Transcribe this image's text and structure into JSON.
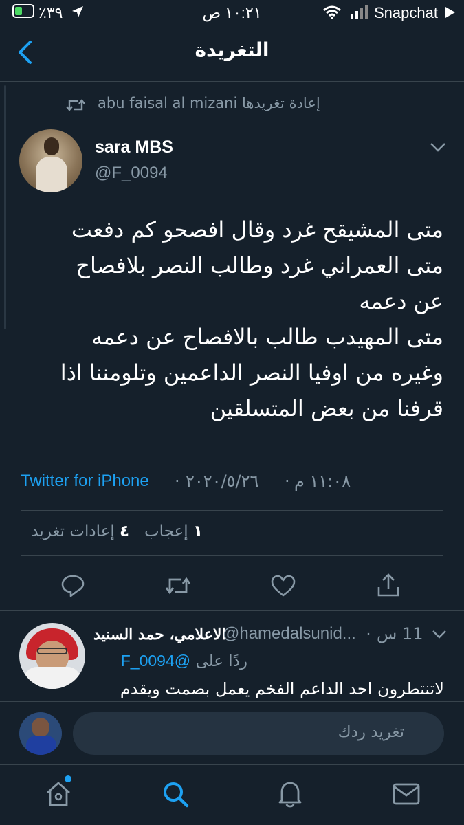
{
  "status_bar": {
    "carrier": "Snapchat",
    "time": "١٠:٢١ ص",
    "battery": "٪٣٩"
  },
  "nav": {
    "title": "التغريدة"
  },
  "retweet_banner": {
    "text": "abu faisal al mizani إعادة تغريدها"
  },
  "tweet": {
    "display_name": "sara MBS",
    "handle": "@F_0094",
    "body": "متى المشيقح غرد وقال افصحو كم دفعت\nمتى العمراني غرد وطالب النصر بلافصاح\nعن دعمه\nمتى المهيدب طالب بالافصاح عن دعمه\nوغيره من اوفيا النصر الداعمين وتلومننا اذا\nقرفنا من بعض المتسلقين",
    "time": "١١:٠٨ م",
    "date": "٢٠٢٠/٥/٢٦",
    "source": "Twitter for iPhone",
    "likes_count": "١",
    "likes_label": "إعجاب",
    "retweets_count": "٤",
    "retweets_label": "إعادات تغريد"
  },
  "reply": {
    "display_name": "الاعلامي، حمد السنيد",
    "handle": "@hamedalsunid...",
    "time_ago": "11 س",
    "replying_to_label": "ردًا على",
    "replying_to_handle": "@F_0094",
    "text": "لاتنتطرون احد الداعم الفخم يعمل بصمت ويقدم"
  },
  "composer": {
    "placeholder": "تغريد ردك"
  },
  "colors": {
    "background": "#15202b",
    "accent": "#1da1f2",
    "muted": "#8899a6",
    "divider": "#38444d"
  },
  "icons": [
    "back-chevron-icon",
    "retweet-icon",
    "chevron-down-icon",
    "reply-icon",
    "retweet-action-icon",
    "like-icon",
    "share-icon",
    "home-icon",
    "search-icon",
    "notifications-icon",
    "messages-icon"
  ]
}
